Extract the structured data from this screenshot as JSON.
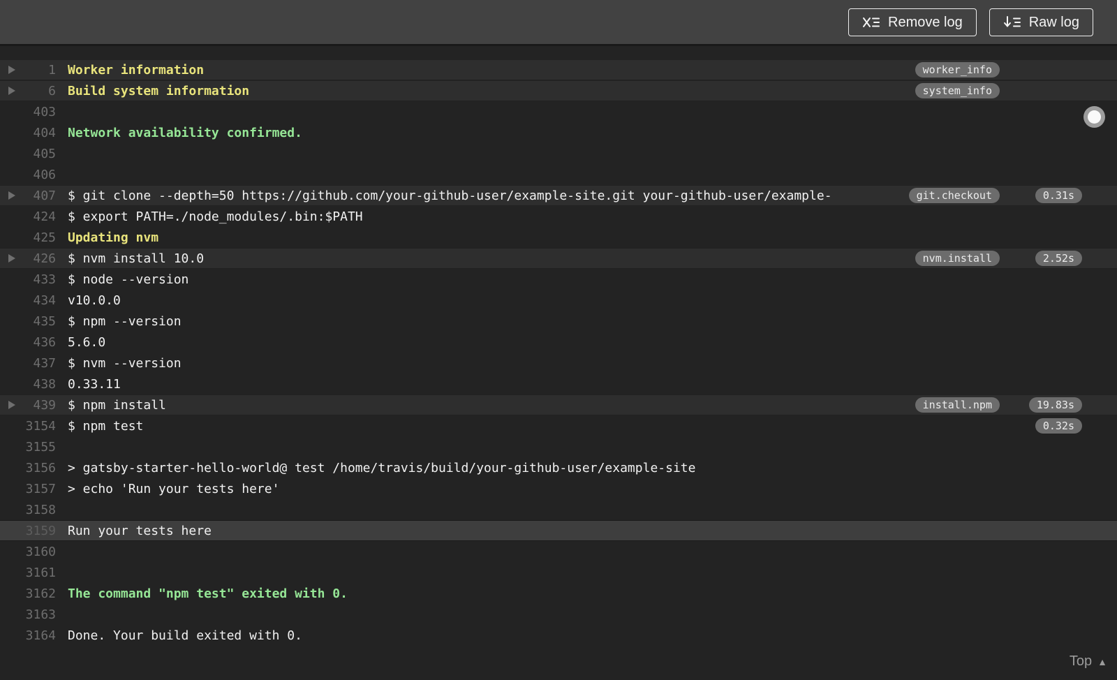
{
  "header": {
    "remove_log_label": "Remove log",
    "raw_log_label": "Raw log"
  },
  "footer": {
    "top_label": "Top"
  },
  "colors": {
    "toolbar_bg": "#424242",
    "log_bg": "#232323",
    "fold_row_bg": "#2e2e2e",
    "highlight_row_bg": "#3e3e3e",
    "text": "#f1f1f1",
    "line_number": "#6e6e6e",
    "ansi_yellow": "#e9e47c",
    "ansi_green": "#96e696",
    "pill_bg": "#6c6c6c"
  },
  "log": {
    "rows": [
      {
        "num": "1",
        "text": "Worker information",
        "style": "yellow-bold",
        "fold": true,
        "tag": "worker_info",
        "duration": ""
      },
      {
        "num": "6",
        "text": "Build system information",
        "style": "yellow-bold",
        "fold": true,
        "tag": "system_info",
        "duration": ""
      },
      {
        "num": "403",
        "text": "",
        "style": "plain",
        "fold": false,
        "tag": "",
        "duration": ""
      },
      {
        "num": "404",
        "text": "Network availability confirmed.",
        "style": "green-bold",
        "fold": false,
        "tag": "",
        "duration": ""
      },
      {
        "num": "405",
        "text": "",
        "style": "plain",
        "fold": false,
        "tag": "",
        "duration": ""
      },
      {
        "num": "406",
        "text": "",
        "style": "plain",
        "fold": false,
        "tag": "",
        "duration": ""
      },
      {
        "num": "407",
        "text": "$ git clone --depth=50 https://github.com/your-github-user/example-site.git your-github-user/example-",
        "style": "plain",
        "fold": true,
        "tag": "git.checkout",
        "duration": "0.31s"
      },
      {
        "num": "424",
        "text": "$ export PATH=./node_modules/.bin:$PATH",
        "style": "plain",
        "fold": false,
        "tag": "",
        "duration": ""
      },
      {
        "num": "425",
        "text": "Updating nvm",
        "style": "yellow-bold",
        "fold": false,
        "tag": "",
        "duration": ""
      },
      {
        "num": "426",
        "text": "$ nvm install 10.0",
        "style": "plain",
        "fold": true,
        "tag": "nvm.install",
        "duration": "2.52s"
      },
      {
        "num": "433",
        "text": "$ node --version",
        "style": "plain",
        "fold": false,
        "tag": "",
        "duration": ""
      },
      {
        "num": "434",
        "text": "v10.0.0",
        "style": "plain",
        "fold": false,
        "tag": "",
        "duration": ""
      },
      {
        "num": "435",
        "text": "$ npm --version",
        "style": "plain",
        "fold": false,
        "tag": "",
        "duration": ""
      },
      {
        "num": "436",
        "text": "5.6.0",
        "style": "plain",
        "fold": false,
        "tag": "",
        "duration": ""
      },
      {
        "num": "437",
        "text": "$ nvm --version",
        "style": "plain",
        "fold": false,
        "tag": "",
        "duration": ""
      },
      {
        "num": "438",
        "text": "0.33.11",
        "style": "plain",
        "fold": false,
        "tag": "",
        "duration": ""
      },
      {
        "num": "439",
        "text": "$ npm install",
        "style": "plain",
        "fold": true,
        "tag": "install.npm",
        "duration": "19.83s"
      },
      {
        "num": "3154",
        "text": "$ npm test",
        "style": "plain",
        "fold": false,
        "tag": "",
        "duration": "0.32s"
      },
      {
        "num": "3155",
        "text": "",
        "style": "plain",
        "fold": false,
        "tag": "",
        "duration": ""
      },
      {
        "num": "3156",
        "text": "> gatsby-starter-hello-world@ test /home/travis/build/your-github-user/example-site",
        "style": "plain",
        "fold": false,
        "tag": "",
        "duration": ""
      },
      {
        "num": "3157",
        "text": "> echo 'Run your tests here'",
        "style": "plain",
        "fold": false,
        "tag": "",
        "duration": ""
      },
      {
        "num": "3158",
        "text": "",
        "style": "plain",
        "fold": false,
        "tag": "",
        "duration": ""
      },
      {
        "num": "3159",
        "text": "Run your tests here",
        "style": "plain",
        "fold": false,
        "tag": "",
        "duration": "",
        "highlighted": true
      },
      {
        "num": "3160",
        "text": "",
        "style": "plain",
        "fold": false,
        "tag": "",
        "duration": ""
      },
      {
        "num": "3161",
        "text": "",
        "style": "plain",
        "fold": false,
        "tag": "",
        "duration": ""
      },
      {
        "num": "3162",
        "text": "The command \"npm test\" exited with 0.",
        "style": "green-bold",
        "fold": false,
        "tag": "",
        "duration": ""
      },
      {
        "num": "3163",
        "text": "",
        "style": "plain",
        "fold": false,
        "tag": "",
        "duration": ""
      },
      {
        "num": "3164",
        "text": "Done. Your build exited with 0.",
        "style": "plain",
        "fold": false,
        "tag": "",
        "duration": ""
      }
    ]
  }
}
